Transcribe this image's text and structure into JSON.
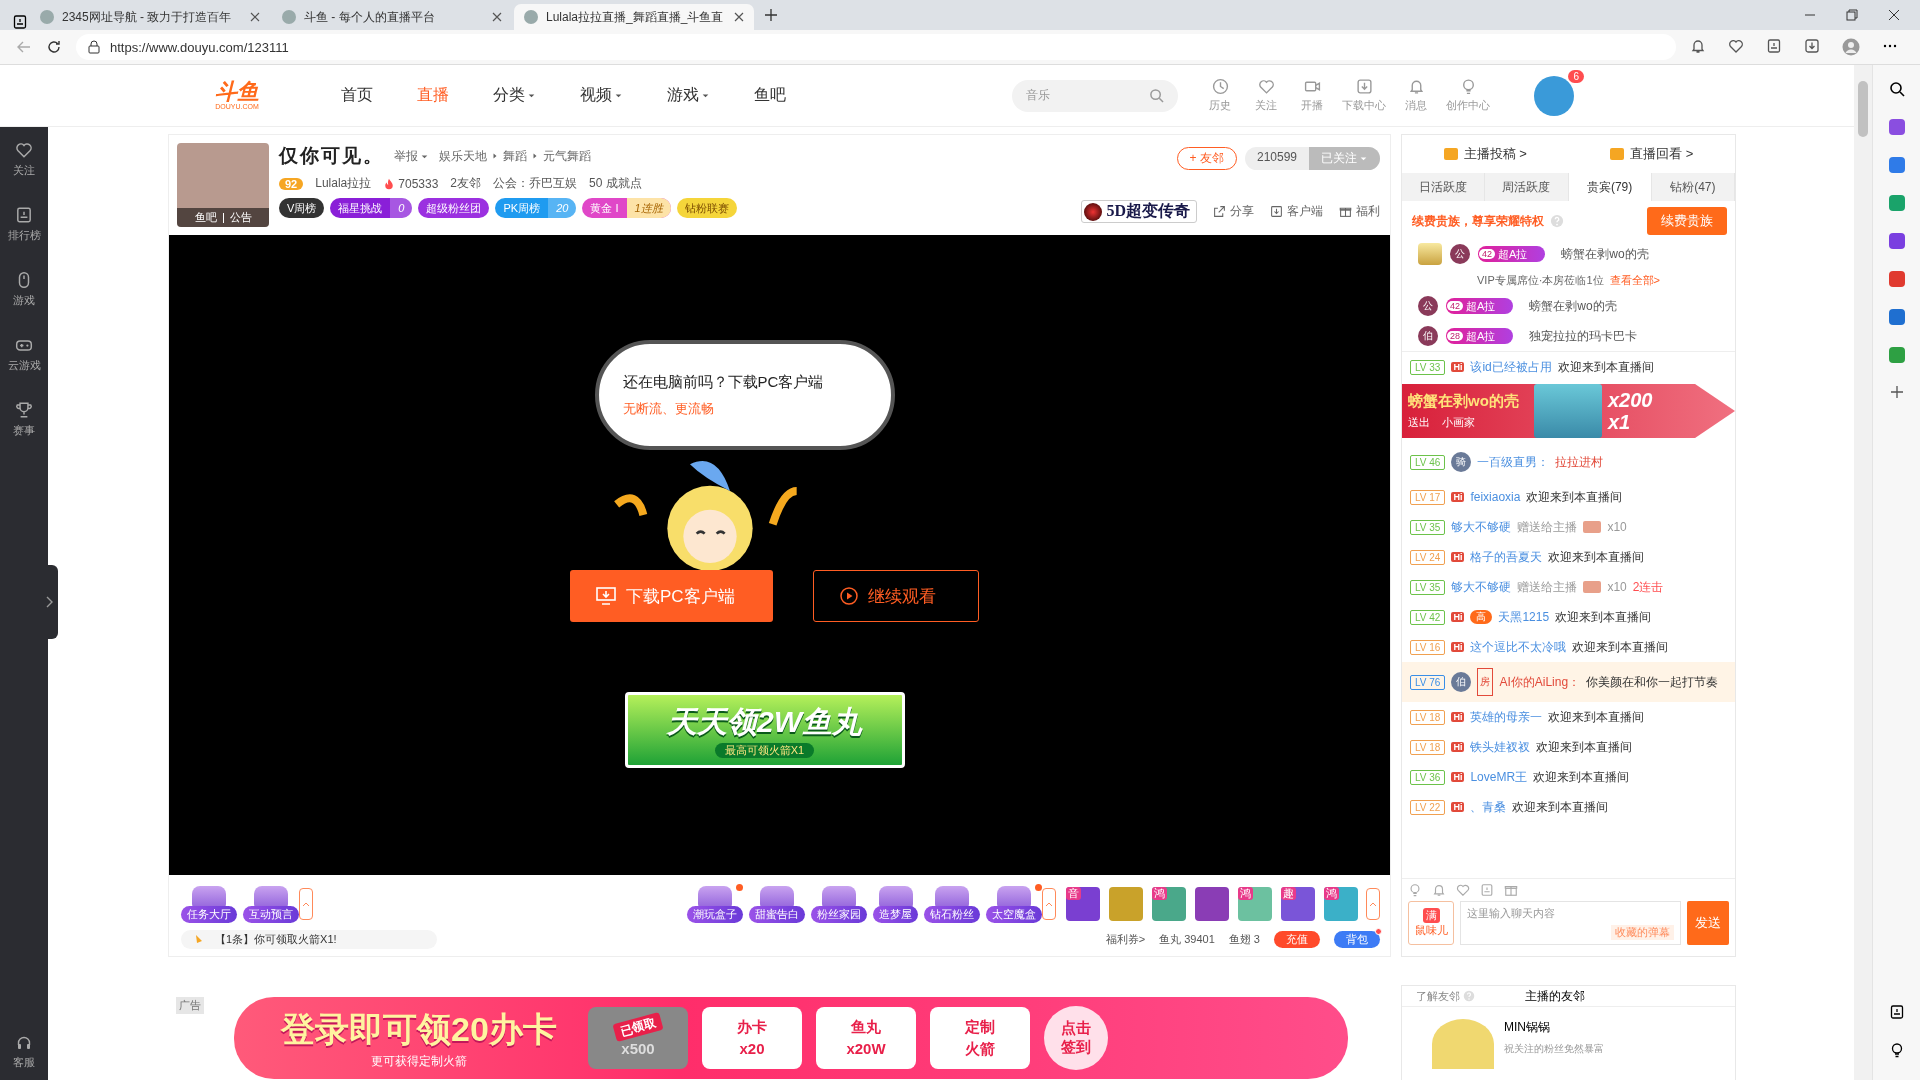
{
  "browser": {
    "tabs": [
      {
        "title": "2345网址导航 - 致力于打造百年",
        "selected": false
      },
      {
        "title": "斗鱼 - 每个人的直播平台",
        "selected": false
      },
      {
        "title": "Lulala拉拉直播_舞蹈直播_斗鱼直",
        "selected": true
      }
    ],
    "url": "https://www.douyu.com/123111"
  },
  "site_header": {
    "logo": {
      "text": "斗鱼",
      "sub": "DOUYU.COM"
    },
    "nav": [
      {
        "label": "首页",
        "selected": false,
        "dropdown": false
      },
      {
        "label": "直播",
        "selected": true,
        "dropdown": false
      },
      {
        "label": "分类",
        "selected": false,
        "dropdown": true
      },
      {
        "label": "视频",
        "selected": false,
        "dropdown": true
      },
      {
        "label": "游戏",
        "selected": false,
        "dropdown": true
      },
      {
        "label": "鱼吧",
        "selected": false,
        "dropdown": false
      }
    ],
    "search": {
      "placeholder": "音乐"
    },
    "tools": [
      {
        "kind": "clock",
        "label": "历史"
      },
      {
        "kind": "heart",
        "label": "关注"
      },
      {
        "kind": "camera",
        "label": "开播"
      },
      {
        "kind": "download",
        "label": "下载中心"
      },
      {
        "kind": "bell",
        "label": "消息"
      },
      {
        "kind": "bulb",
        "label": "创作中心"
      }
    ],
    "avatar_badge": "6"
  },
  "left_nav": [
    {
      "kind": "heart",
      "label": "关注"
    },
    {
      "kind": "rank",
      "label": "排行榜"
    },
    {
      "kind": "mouse",
      "label": "游戏"
    },
    {
      "kind": "gamepad",
      "label": "云游戏"
    },
    {
      "kind": "trophy",
      "label": "赛事"
    }
  ],
  "left_nav_bottom": {
    "label": "客服"
  },
  "stream": {
    "title": "仅你可见。",
    "report": "举报",
    "breadcrumbs": [
      "娱乐天地",
      "舞蹈",
      "元气舞蹈"
    ],
    "avatar_links": [
      "鱼吧",
      "公告"
    ],
    "level": "92",
    "anchor": "Lulala拉拉",
    "heat": "705333",
    "friends": "2友邻",
    "guild": "公会：乔巴互娱",
    "achievements": "50 成就点",
    "badges": [
      {
        "kind": "dark",
        "label": "V周榜"
      },
      {
        "kind": "violet",
        "label": "福星挑战",
        "value": "0"
      },
      {
        "kind": "purple",
        "label": "超级粉丝团"
      },
      {
        "kind": "blue",
        "label": "PK周榜",
        "value": "20"
      },
      {
        "kind": "pink",
        "label": "黄金 I",
        "value": "1连胜"
      },
      {
        "kind": "yellow",
        "label": "钻粉联赛"
      }
    ],
    "friend_button": "+ 友邻",
    "followers": "210599",
    "follow_button": "已关注",
    "ad_logo": "5D超变传奇",
    "actions": [
      {
        "kind": "share",
        "label": "分享"
      },
      {
        "kind": "client",
        "label": "客户端"
      },
      {
        "kind": "gift",
        "label": "福利"
      }
    ],
    "video": {
      "bubble_title": "还在电脑前吗？下载PC客户端",
      "bubble_sub": "无断流、更流畅",
      "download_button": "下载PC客户端",
      "continue_button": "继续观看",
      "promo_title": "天天领2W鱼丸",
      "promo_sub": "最高可领火箭X1"
    },
    "tool_groups": [
      [
        {
          "label": "任务大厅",
          "dot": false
        },
        {
          "label": "互动预言",
          "dot": false
        }
      ],
      [
        {
          "label": "潮玩盒子",
          "dot": true
        },
        {
          "label": "甜蜜告白",
          "dot": false
        },
        {
          "label": "粉丝家园",
          "dot": false
        },
        {
          "label": "造梦屋",
          "dot": false
        },
        {
          "label": "钻石粉丝",
          "dot": false
        },
        {
          "label": "太空魔盒",
          "dot": true
        }
      ]
    ],
    "gifts": [
      {
        "tag": "音",
        "color": "#7a3fd1"
      },
      {
        "color": "#c9a22a"
      },
      {
        "tag": "鸿",
        "color": "#4aa88a"
      },
      {
        "color": "#8a3db5"
      },
      {
        "tag": "鸿",
        "color": "#6cc1a0"
      },
      {
        "tag": "趣",
        "color": "#7a55d8"
      },
      {
        "tag": "鸿",
        "color": "#3bb0c8"
      }
    ],
    "notice": "【1条】你可领取火箭X1!",
    "coupon": "福利券>",
    "fish_balls": "鱼丸 39401",
    "fish_fins": "鱼翅 3",
    "recharge": "充值",
    "backpack": "背包"
  },
  "panel": {
    "links": [
      "主播投稿 >",
      "直播回看 >"
    ],
    "tabs": [
      {
        "label": "日活跃度",
        "selected": false
      },
      {
        "label": "周活跃度",
        "selected": false
      },
      {
        "label": "贵宾(79)",
        "selected": true
      },
      {
        "label": "钻粉(47)",
        "selected": false
      }
    ],
    "vip_promo": "续费贵族，尊享荣耀特权",
    "vip_button": "续费贵族",
    "vips": [
      {
        "top": true,
        "noble": "公",
        "level": "42",
        "title": "超A拉",
        "name": "螃蟹在剥wo的壳"
      }
    ],
    "vip_divider": "VIP专属席位·本房莅临1位",
    "vip_link": "查看全部>",
    "vips_more": [
      {
        "top": false,
        "noble": "公",
        "level": "42",
        "title": "超A拉",
        "name": "螃蟹在剥wo的壳"
      },
      {
        "top": false,
        "noble": "伯",
        "level": "28",
        "title": "超A拉",
        "name": "独宠拉拉的玛卡巴卡"
      }
    ],
    "chat": [
      {
        "kind": "welcome",
        "lv": "LV 33",
        "color": "#6cc24a",
        "hi": "Hi",
        "user": "该id已经被占用",
        "text": "欢迎来到本直播间"
      },
      {
        "kind": "banner",
        "user": "螃蟹在剥wo的壳",
        "verb": "送出",
        "gift": "小画家",
        "amount": "x200",
        "count": "x1"
      },
      {
        "kind": "chat",
        "lv": "LV 46",
        "color": "#6cc24a",
        "noble": "骑",
        "user": "一百级直男：",
        "text": "拉拉进村",
        "highlighted": false
      },
      {
        "kind": "welcome",
        "lv": "LV 17",
        "color": "#f0a050",
        "hi": "Hi",
        "user": "feixiaoxia",
        "text": "欢迎来到本直播间"
      },
      {
        "kind": "gift",
        "lv": "LV 35",
        "color": "#6cc24a",
        "user": "够大不够硬",
        "text": "赠送给主播",
        "count": "x10"
      },
      {
        "kind": "welcome",
        "lv": "LV 24",
        "color": "#f0a050",
        "hi": "Hi",
        "user": "格子的吾夏天",
        "text": "欢迎来到本直播间"
      },
      {
        "kind": "gift",
        "lv": "LV 35",
        "color": "#6cc24a",
        "user": "够大不够硬",
        "text": "赠送给主播",
        "count": "x10",
        "combo": "2连击"
      },
      {
        "kind": "welcome",
        "lv": "LV 42",
        "color": "#6cc24a",
        "hi": "Hi",
        "badge": "高",
        "user": "天黑1215",
        "text": "欢迎来到本直播间"
      },
      {
        "kind": "welcome",
        "lv": "LV 16",
        "color": "#f0a050",
        "hi": "Hi",
        "user": "这个逗比不太冷哦",
        "text": "欢迎来到本直播间"
      },
      {
        "kind": "chat",
        "lv": "LV 76",
        "color": "#3a8ee6",
        "noble": "伯",
        "room_tag": "房",
        "user": "AI你的AiLing：",
        "text": "你美颜在和你一起打节奏",
        "highlighted": true
      },
      {
        "kind": "welcome",
        "lv": "LV 18",
        "color": "#f0a050",
        "hi": "Hi",
        "user": "英雄的母亲一",
        "text": "欢迎来到本直播间"
      },
      {
        "kind": "welcome",
        "lv": "LV 18",
        "color": "#f0a050",
        "hi": "Hi",
        "user": "铁头娃衩衩",
        "text": "欢迎来到本直播间"
      },
      {
        "kind": "welcome",
        "lv": "LV 36",
        "color": "#6cc24a",
        "hi": "Hi",
        "user": "LoveMR王",
        "text": "欢迎来到本直播间"
      },
      {
        "kind": "welcome",
        "lv": "LV 22",
        "color": "#f0a050",
        "hi": "Hi",
        "user": "、青桑",
        "text": "欢迎来到本直播间"
      }
    ],
    "fan_badge": {
      "tag": "满",
      "name": "鼠味儿"
    },
    "input": {
      "placeholder": "这里输入聊天内容",
      "saved": "收藏的弹幕",
      "send": "发送"
    }
  },
  "ad": {
    "tag": "广告",
    "title": "登录即可领20办卡",
    "sub": "更可获得定制火箭",
    "items": [
      {
        "kind": "claimed",
        "stamp": "已领取",
        "label": "x500"
      },
      {
        "kind": "card",
        "label": "办卡",
        "value": "x20"
      },
      {
        "kind": "ball",
        "label": "鱼丸",
        "value": "x20W"
      },
      {
        "kind": "rocket",
        "label": "定制",
        "value": "火箭"
      }
    ],
    "cta": [
      "点击",
      "签到"
    ]
  },
  "friends": {
    "about": "了解友邻",
    "title": "主播的友邻",
    "name": "MIN锅锅",
    "desc": "祝关注的粉丝免然暴富"
  }
}
